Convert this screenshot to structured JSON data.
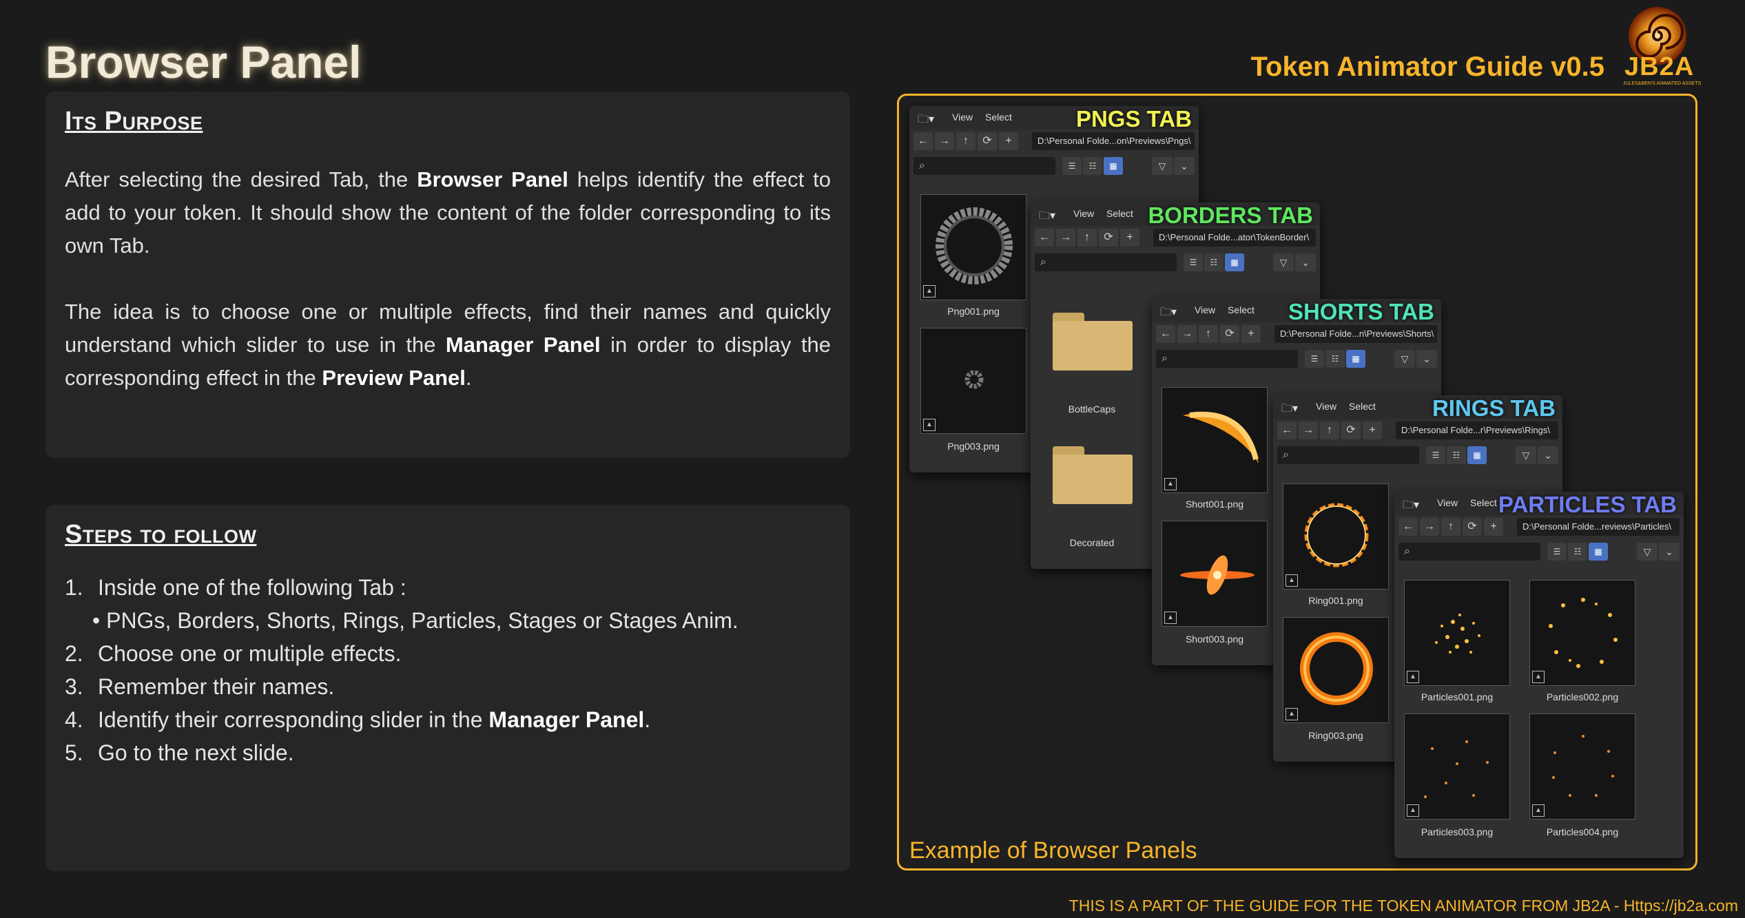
{
  "page_title": "Browser Panel",
  "guide_title": "Token Animator Guide v0.5",
  "logo": {
    "text": "JB2A",
    "subtitle": "JULES&BEN'S ANIMATED ASSETS"
  },
  "purpose": {
    "heading": "Its Purpose",
    "p1_a": "After selecting the desired Tab, the ",
    "p1_b": "Browser Panel",
    "p1_c": " helps identify the effect to add to your token. It should show the content of the folder corresponding to its own Tab.",
    "p2_a": "The idea is to choose one or multiple effects, find their names and quickly understand which slider to use in the ",
    "p2_b": "Manager Panel",
    "p2_c": " in order to display the corresponding effect in the ",
    "p2_d": "Preview Panel",
    "p2_e": "."
  },
  "steps": {
    "heading": "Steps to follow",
    "s1_num": "1.",
    "s1": "Inside one of the following Tab :",
    "s1_sub": "PNGs, Borders, Shorts, Rings, Particles, Stages or Stages Anim.",
    "s2_num": "2.",
    "s2": "Choose one or multiple effects.",
    "s3_num": "3.",
    "s3": "Remember their names.",
    "s4_num": "4.",
    "s4_a": "Identify their corresponding slider in the ",
    "s4_b": "Manager Panel",
    "s4_c": ".",
    "s5_num": "5.",
    "s5": "Go to the next slide."
  },
  "example_caption": "Example of Browser Panels",
  "footer": "THIS IS A PART OF THE GUIDE FOR THE TOKEN ANIMATOR FROM JB2A - Https://jb2a.com",
  "menu": {
    "view": "View",
    "select": "Select"
  },
  "panels": {
    "pngs": {
      "label": "PNGS TAB",
      "label_color": "#f2f252",
      "path": "D:\\Personal Folde...on\\Previews\\Pngs\\",
      "items": [
        "Png001.png",
        "Png003.png"
      ]
    },
    "borders": {
      "label": "BORDERS TAB",
      "label_color": "#5ee85e",
      "path": "D:\\Personal Folde...ator\\TokenBorder\\",
      "items": [
        "BottleCaps",
        "Decorated"
      ]
    },
    "shorts": {
      "label": "SHORTS TAB",
      "label_color": "#4fe3b8",
      "path": "D:\\Personal Folde...n\\Previews\\Shorts\\",
      "items": [
        "Short001.png",
        "Short003.png"
      ]
    },
    "rings": {
      "label": "RINGS TAB",
      "label_color": "#5ec8f0",
      "path": "D:\\Personal Folde...r\\Previews\\Rings\\",
      "items": [
        "Ring001.png",
        "Ring003.png"
      ]
    },
    "particles": {
      "label": "PARTICLES TAB",
      "label_color": "#6f7cf2",
      "path": "D:\\Personal Folde...reviews\\Particles\\",
      "items": [
        "Particles001.png",
        "Particles002.png",
        "Particles003.png",
        "Particles004.png"
      ]
    }
  }
}
